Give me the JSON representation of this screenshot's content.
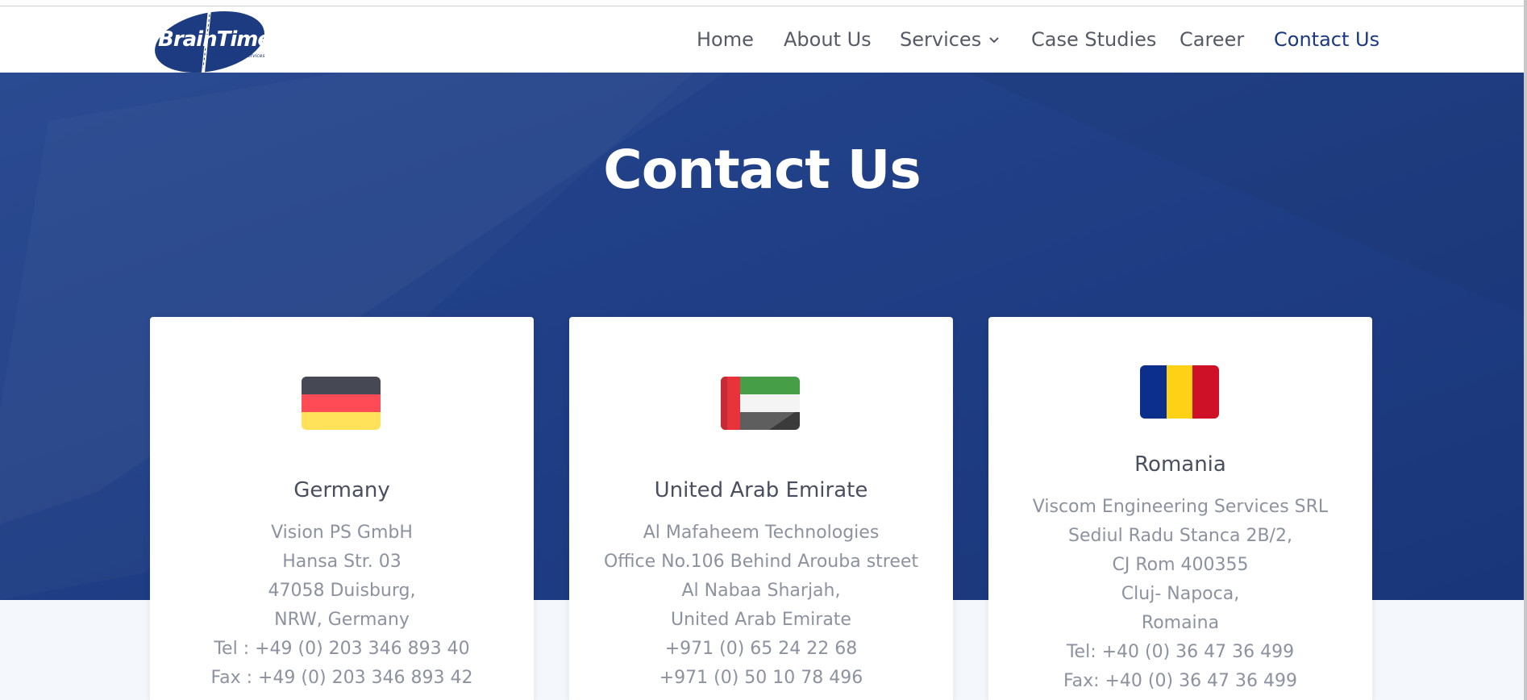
{
  "brand": {
    "name_part1": "Brain",
    "name_part2": "Time",
    "tagline": "Professional Services"
  },
  "nav": {
    "items": [
      {
        "label": "Home"
      },
      {
        "label": "About Us"
      },
      {
        "label": "Services"
      },
      {
        "label": "Case Studies"
      },
      {
        "label": "Career"
      },
      {
        "label": "Contact Us"
      }
    ],
    "active": "Contact Us"
  },
  "hero": {
    "title": "Contact Us"
  },
  "offices": [
    {
      "country": "Germany",
      "flag_icon": "germany-flag-icon",
      "lines": [
        "Vision PS GmbH",
        "Hansa Str. 03",
        "47058 Duisburg,",
        "NRW, Germany",
        "Tel : +49 (0) 203 346 893 40",
        "Fax : +49 (0) 203 346 893 42"
      ]
    },
    {
      "country": "United Arab Emirate",
      "flag_icon": "uae-flag-icon",
      "lines": [
        "Al Mafaheem Technologies",
        "Office No.106 Behind Arouba street",
        "Al Nabaa Sharjah,",
        "United Arab Emirate",
        "+971 (0) 65 24 22 68",
        "+971 (0) 50 10 78 496"
      ]
    },
    {
      "country": "Romania",
      "flag_icon": "romania-flag-icon",
      "lines": [
        "Viscom Engineering Services SRL",
        "Sediul Radu Stanca 2B/2,",
        "CJ Rom 400355",
        "Cluj- Napoca,",
        "Romaina",
        "Tel: +40 (0) 36 47 36 499",
        "Fax: +40 (0) 36 47 36 499"
      ]
    }
  ],
  "colors": {
    "brand_blue": "#1d3b80",
    "nav_active": "#1c3880",
    "nav_text": "#555a66",
    "muted_text": "#8d92a0"
  }
}
